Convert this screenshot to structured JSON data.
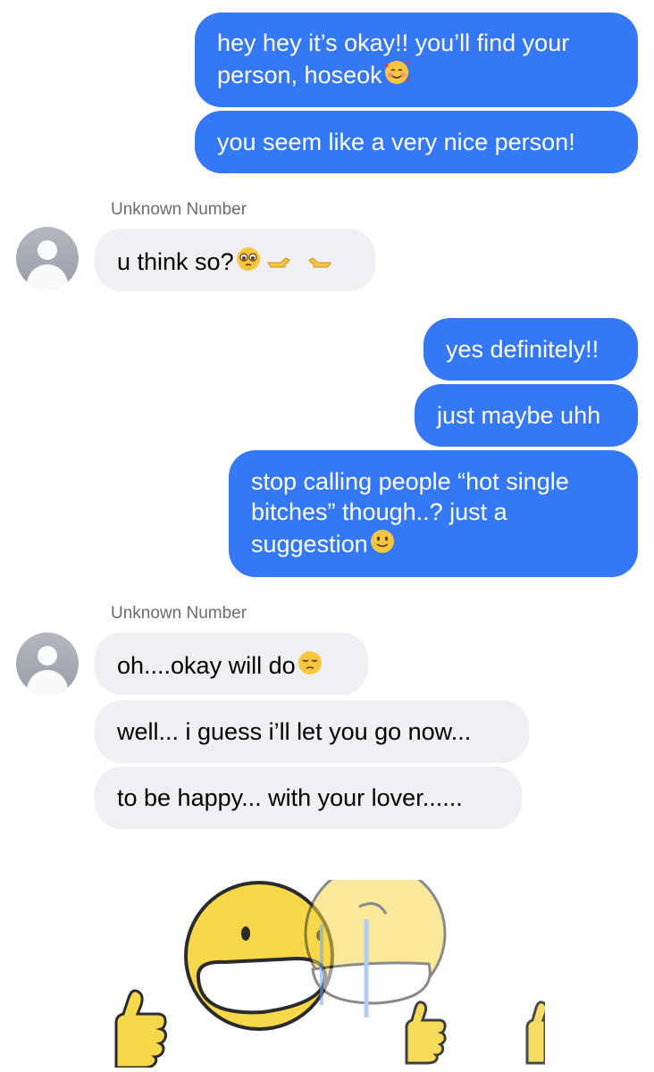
{
  "conversation": {
    "sender_label": "Unknown Number",
    "messages": [
      {
        "from": "me",
        "text": "hey hey it’s okay!! you’ll find your\nperson, hoseok",
        "emoji": "smiling-face-with-hearts-icon"
      },
      {
        "from": "me",
        "text": "you seem like a very nice person!"
      },
      {
        "from": "them",
        "text": "u think so?",
        "emoji": "pleading-face-pointing-fingers-icon"
      },
      {
        "from": "me",
        "text": "yes definitely!!"
      },
      {
        "from": "me",
        "text": "just maybe uhh"
      },
      {
        "from": "me",
        "text": "stop calling people “hot single\nbitches” though..? just a\nsuggestion",
        "emoji": "slightly-smiling-face-icon"
      },
      {
        "from": "them",
        "text": "oh....okay will do",
        "emoji": "pensive-face-icon"
      },
      {
        "from": "them",
        "text": "well... i guess i’ll let you go now..."
      },
      {
        "from": "them",
        "text": "to be happy... with your lover......"
      }
    ],
    "sticker": "crying-smiley-thumbs-up-sticker"
  },
  "colors": {
    "sent_bubble": "#3478f6",
    "received_bubble": "#efeff4",
    "label_gray": "#6b6b70",
    "smiley_yellow": "#f6d84a"
  }
}
